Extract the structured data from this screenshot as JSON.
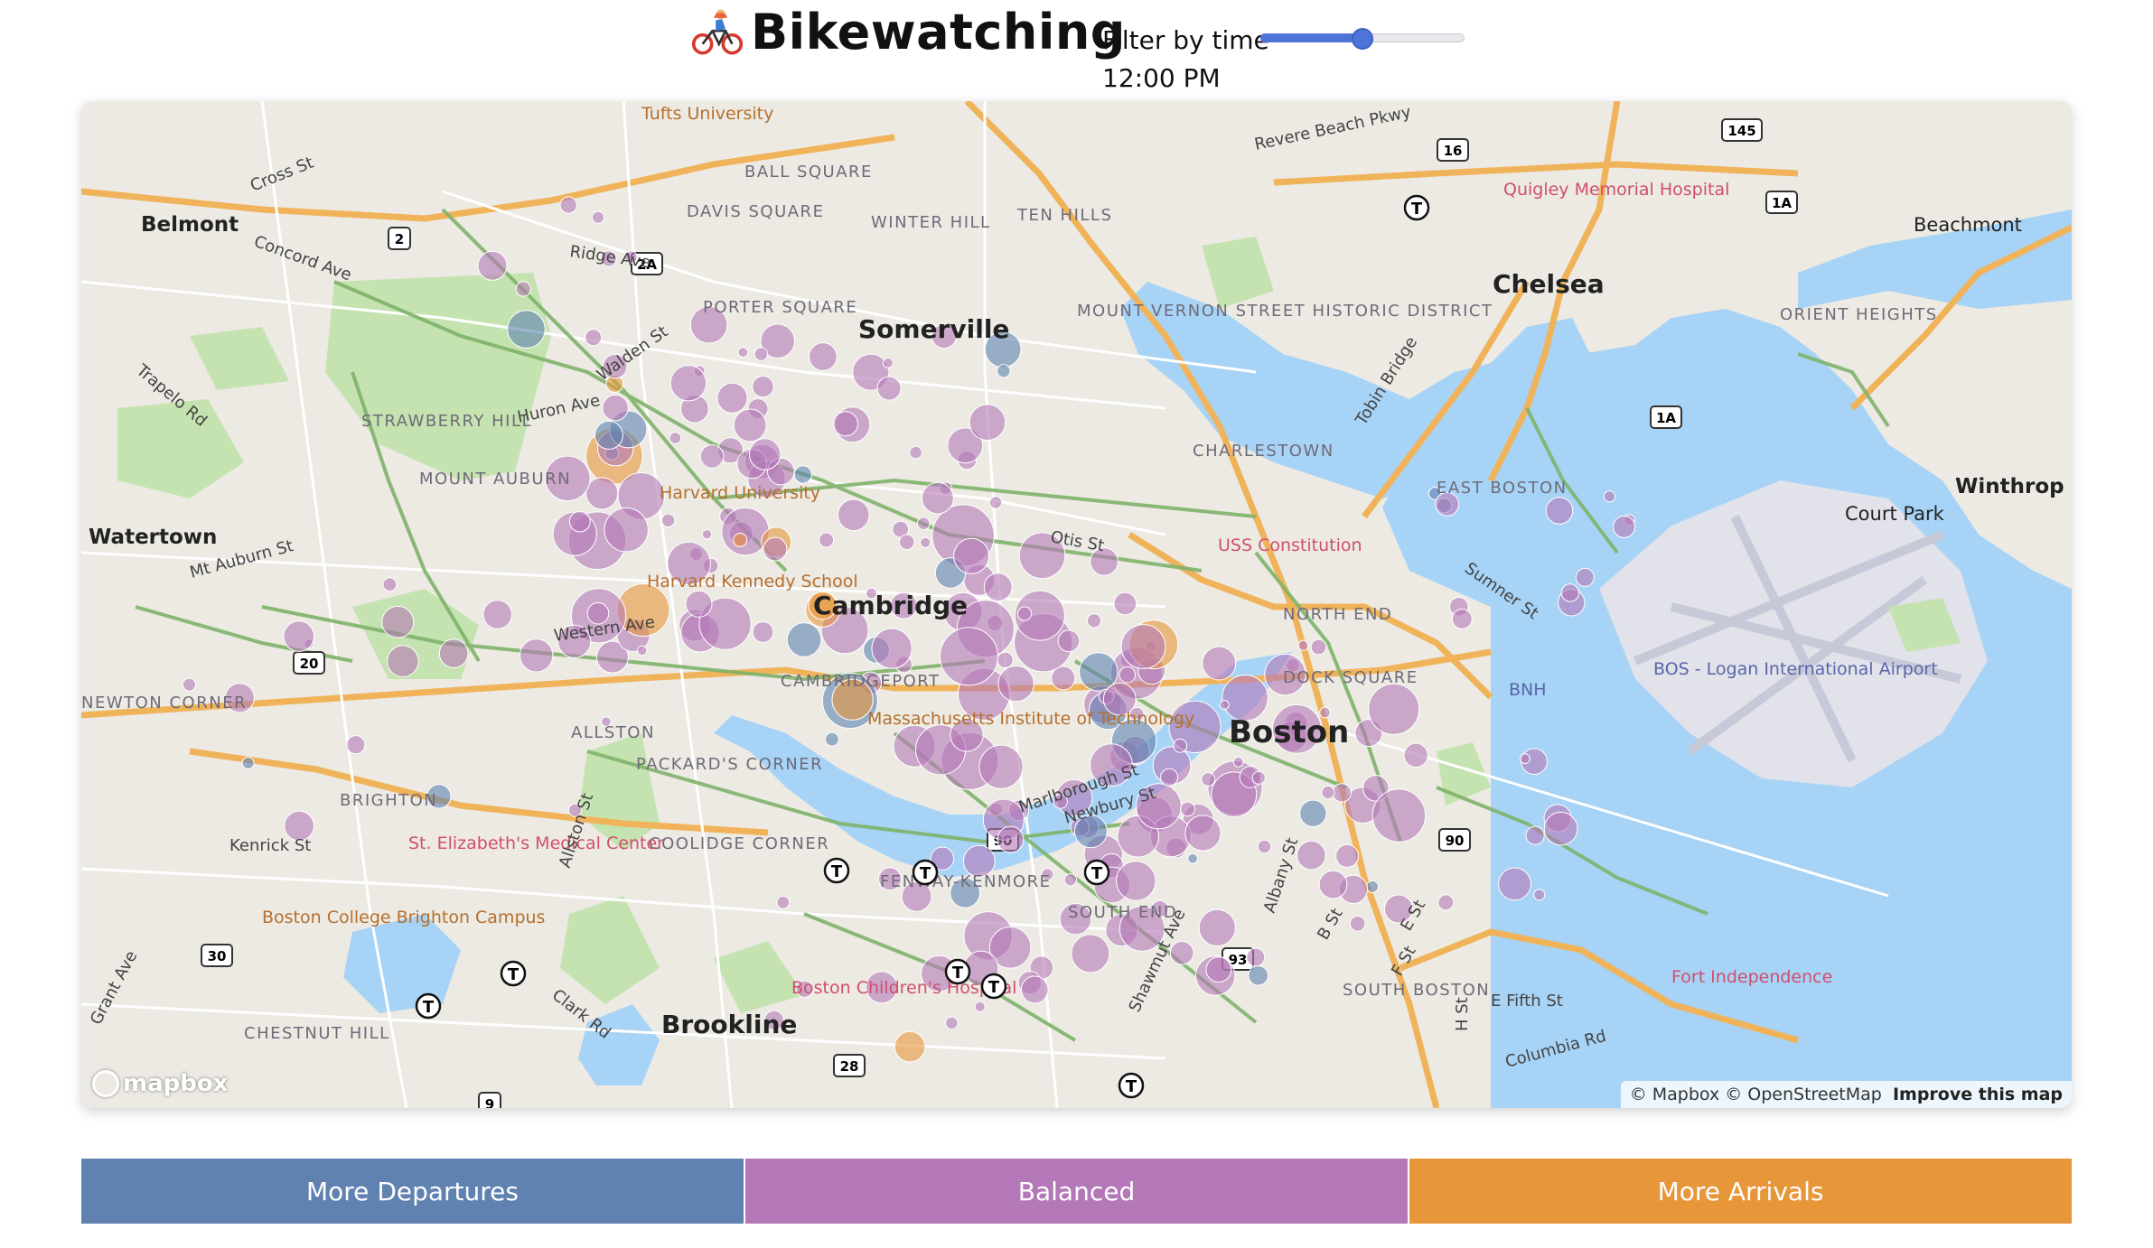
{
  "header": {
    "title": "Bikewatching",
    "filter_label": "Filter by time",
    "time_value": "12:00 PM",
    "slider_fraction": 0.5
  },
  "map": {
    "places": {
      "somerville": "Somerville",
      "cambridge": "Cambridge",
      "boston": "Boston",
      "chelsea": "Chelsea",
      "brookline": "Brookline",
      "belmont": "Belmont",
      "watertown": "Watertown",
      "winthrop": "Winthrop",
      "beachmont": "Beachmont",
      "court_park": "Court Park",
      "charlestown": "CHARLESTOWN",
      "east_boston": "EAST BOSTON",
      "north_end": "NORTH END",
      "south_end": "SOUTH END",
      "south_boston": "SOUTH BOSTON",
      "allston": "ALLSTON",
      "brighton": "BRIGHTON",
      "fenway": "FENWAY-KENMORE",
      "chestnut_hill": "CHESTNUT HILL",
      "newton_corner": "NEWTON CORNER",
      "cambridgeport": "CAMBRIDGEPORT",
      "mit": "Massachusetts Institute of Technology",
      "harvard": "Harvard University",
      "airport": "BOS - Logan International Airport",
      "fort": "Fort Independence",
      "uss": "USS Constitution",
      "tufts": "Tufts University",
      "davis": "DAVIS SQUARE",
      "porter": "PORTER SQUARE",
      "winter_hill": "WINTER HILL",
      "ten_hills": "TEN HILLS",
      "ball_square": "BALL SQUARE",
      "dock_square": "DOCK SQUARE",
      "orient_heights": "ORIENT HEIGHTS",
      "strawberry_hill": "STRAWBERRY HILL",
      "mount_auburn": "MOUNT AUBURN",
      "coolidge": "COOLIDGE CORNER",
      "packards": "PACKARD'S CORNER",
      "st_elizabeth": "St. Elizabeth's Medical Center",
      "boston_college": "Boston College Brighton Campus",
      "childrens": "Boston Children's Hospital",
      "quigley": "Quigley Memorial Hospital",
      "mount_vernon": "MOUNT VERNON STREET HISTORIC DISTRICT",
      "bnh": "BNH",
      "kennedy": "Harvard Kennedy School"
    },
    "roads": {
      "revere_beach": "Revere Beach Pkwy",
      "cross_st": "Cross St",
      "concord_ave": "Concord Ave",
      "ridge_ave": "Ridge Ave",
      "huron_ave": "Huron Ave",
      "walden_st": "Walden St",
      "mt_auburn_st": "Mt Auburn St",
      "western_ave": "Western Ave",
      "kenrick_st": "Kenrick St",
      "allston_st": "Allston St",
      "clark_rd": "Clark Rd",
      "grant_ave": "Grant Ave",
      "marlborough": "Marlborough St",
      "newbury": "Newbury St",
      "albany": "Albany St",
      "shawmut": "Shawmut Ave",
      "e_fifth": "E Fifth St",
      "columbia": "Columbia Rd",
      "sumner": "Sumner St",
      "tobin": "Tobin Bridge",
      "otis": "Otis St",
      "trapelo": "Trapelo Rd",
      "b_st": "B St",
      "e_st": "E St",
      "f_st": "F St",
      "h_st": "H St"
    },
    "shields": [
      "2",
      "2A",
      "16",
      "145",
      "1A",
      "1A",
      "20",
      "90",
      "90",
      "93",
      "30",
      "28",
      "9"
    ],
    "mapbox_logo": "mapbox",
    "attribution": "© Mapbox © OpenStreetMap",
    "improve": "Improve this map"
  },
  "legend": {
    "departures": "More Departures",
    "balanced": "Balanced",
    "arrivals": "More Arrivals"
  },
  "colors": {
    "departures": "#5f82b1",
    "balanced": "#b478b8",
    "arrivals": "#e8963a",
    "water": "#a7d3f6",
    "park": "#c5e3b0",
    "land": "#eceae3",
    "slider": "#4f74d9"
  }
}
